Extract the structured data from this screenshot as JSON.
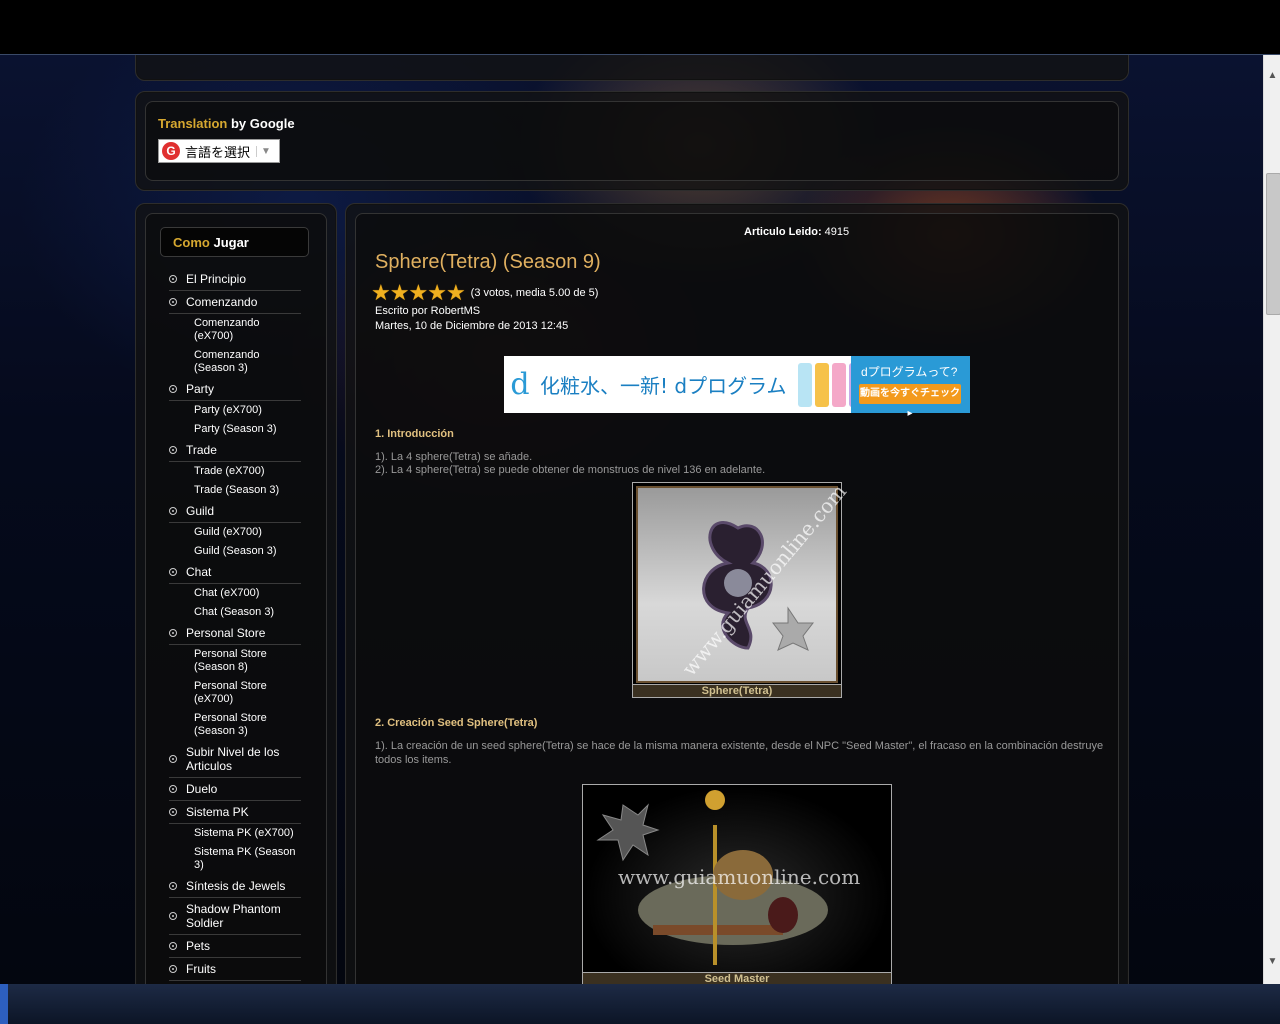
{
  "translation": {
    "brand": "Translation",
    "by": "by Google",
    "select_label": "言語を選択",
    "g_letter": "G"
  },
  "sidebar": {
    "title_a": "Como",
    "title_b": "Jugar",
    "items": [
      {
        "label": "El Principio"
      },
      {
        "label": "Comenzando",
        "subs": [
          "Comenzando (eX700)",
          "Comenzando (Season 3)"
        ]
      },
      {
        "label": "Party",
        "subs": [
          "Party (eX700)",
          "Party (Season 3)"
        ]
      },
      {
        "label": "Trade",
        "subs": [
          "Trade (eX700)",
          "Trade (Season 3)"
        ]
      },
      {
        "label": "Guild",
        "subs": [
          "Guild (eX700)",
          "Guild (Season 3)"
        ]
      },
      {
        "label": "Chat",
        "subs": [
          "Chat (eX700)",
          "Chat (Season 3)"
        ]
      },
      {
        "label": "Personal Store",
        "subs": [
          "Personal Store (Season 8)",
          "Personal Store (eX700)",
          "Personal Store (Season 3)"
        ]
      },
      {
        "label": "Subir Nivel de los Articulos"
      },
      {
        "label": "Duelo"
      },
      {
        "label": "Sistema PK",
        "subs": [
          "Sistema PK (eX700)",
          "Sistema PK (Season 3)"
        ]
      },
      {
        "label": "Síntesis de Jewels"
      },
      {
        "label": "Shadow Phantom Soldier"
      },
      {
        "label": "Pets"
      },
      {
        "label": "Fruits"
      }
    ]
  },
  "article": {
    "read_label": "Articulo Leido:",
    "read_count": "4915",
    "title": "Sphere(Tetra) (Season 9)",
    "rating": 5,
    "votes": "(3 votos, media 5.00 de 5)",
    "author": "Escrito por RobertMS",
    "date": "Martes, 10 de Diciembre de 2013 12:45",
    "ad": {
      "logo": "d",
      "text": "化粧水、一新! dプログラム",
      "right_title": "dプログラムって?",
      "right_button": "動画を今すぐチェック▸",
      "bottle_colors": [
        "#b8e4f4",
        "#f6c24a",
        "#f4a8c8",
        "#c8a8e8"
      ]
    },
    "section1": {
      "heading": "1. Introducción",
      "lines": [
        "1). La 4 sphere(Tetra) se añade.",
        "2). La 4 sphere(Tetra) se puede obtener de monstruos de nivel 136 en adelante."
      ],
      "figure_caption": "Sphere(Tetra)",
      "watermark": "www.guiamuonline.com"
    },
    "section2": {
      "heading": "2. Creación Seed Sphere(Tetra)",
      "lines": [
        "1). La creación de un seed sphere(Tetra) se hace de la misma manera existente, desde el NPC \"Seed Master\", el fracaso en la combinación destruye",
        "todos los items."
      ],
      "figure_caption": "Seed Master",
      "watermark": "www.guiamuonline.com"
    }
  },
  "scrollbar": {
    "up": "▲",
    "down": "▼"
  }
}
